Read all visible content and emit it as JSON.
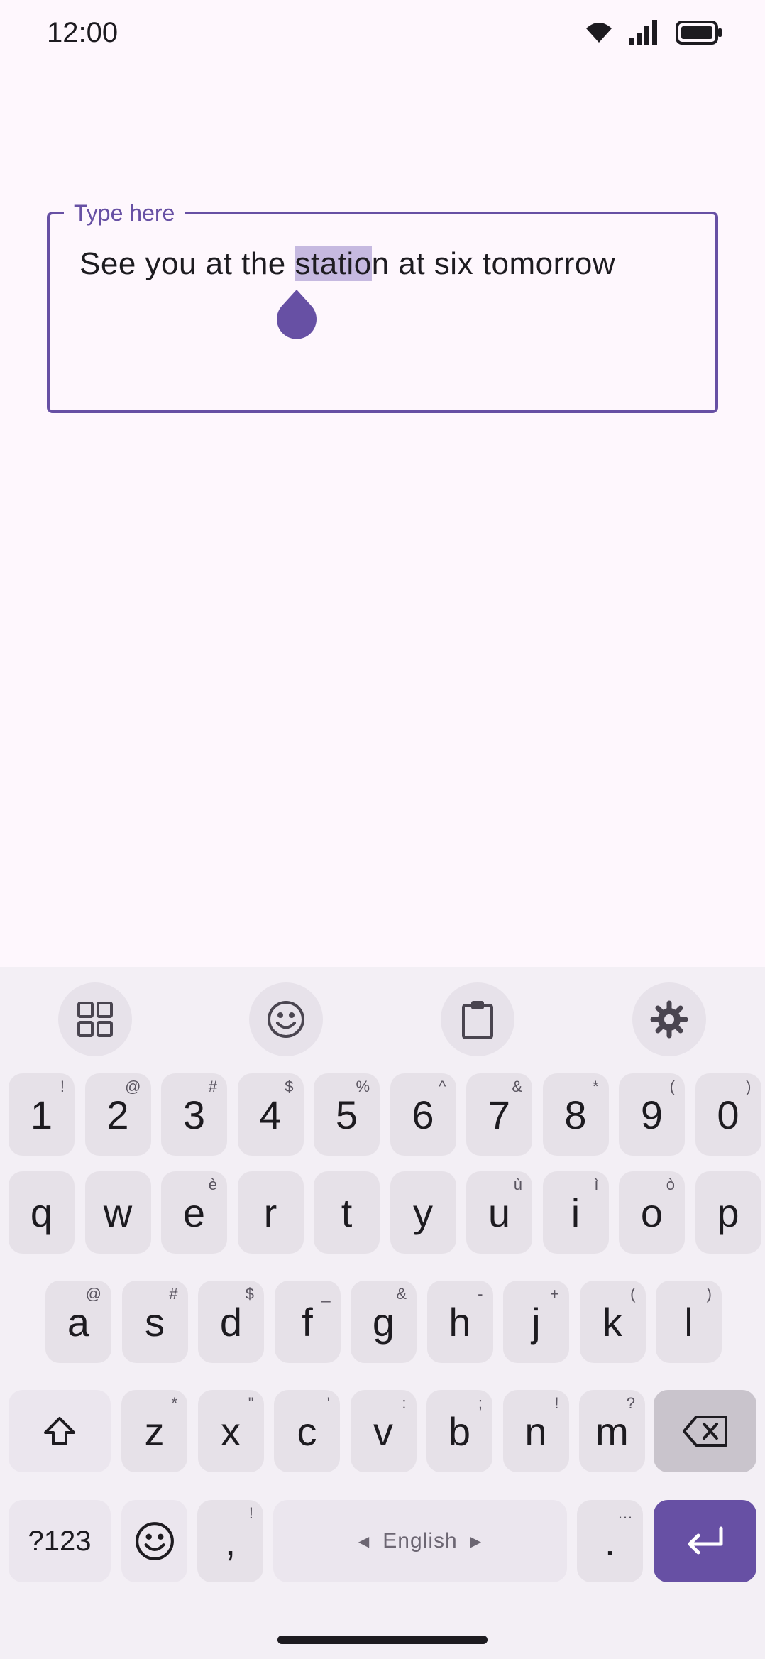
{
  "status": {
    "time": "12:00"
  },
  "field": {
    "label": "Type here",
    "text_before": "See you at the ",
    "text_selected": "statio",
    "text_after": "n at six tomorrow"
  },
  "keyboard": {
    "row_numbers": [
      {
        "main": "1",
        "hint": "!"
      },
      {
        "main": "2",
        "hint": "@"
      },
      {
        "main": "3",
        "hint": "#"
      },
      {
        "main": "4",
        "hint": "$"
      },
      {
        "main": "5",
        "hint": "%"
      },
      {
        "main": "6",
        "hint": "^"
      },
      {
        "main": "7",
        "hint": "&"
      },
      {
        "main": "8",
        "hint": "*"
      },
      {
        "main": "9",
        "hint": "("
      },
      {
        "main": "0",
        "hint": ")"
      }
    ],
    "row_q": [
      {
        "main": "q",
        "hint": ""
      },
      {
        "main": "w",
        "hint": ""
      },
      {
        "main": "e",
        "hint": "è"
      },
      {
        "main": "r",
        "hint": ""
      },
      {
        "main": "t",
        "hint": ""
      },
      {
        "main": "y",
        "hint": ""
      },
      {
        "main": "u",
        "hint": "ù"
      },
      {
        "main": "i",
        "hint": "ì"
      },
      {
        "main": "o",
        "hint": "ò"
      },
      {
        "main": "p",
        "hint": ""
      }
    ],
    "row_a": [
      {
        "main": "a",
        "hint": "@"
      },
      {
        "main": "s",
        "hint": "#"
      },
      {
        "main": "d",
        "hint": "$"
      },
      {
        "main": "f",
        "hint": "_"
      },
      {
        "main": "g",
        "hint": "&"
      },
      {
        "main": "h",
        "hint": "-"
      },
      {
        "main": "j",
        "hint": "+"
      },
      {
        "main": "k",
        "hint": "("
      },
      {
        "main": "l",
        "hint": ")"
      }
    ],
    "row_z": [
      {
        "main": "z",
        "hint": "*"
      },
      {
        "main": "x",
        "hint": "\""
      },
      {
        "main": "c",
        "hint": "'"
      },
      {
        "main": "v",
        "hint": ":"
      },
      {
        "main": "b",
        "hint": ";"
      },
      {
        "main": "n",
        "hint": "!"
      },
      {
        "main": "m",
        "hint": "?"
      }
    ],
    "symbols_label": "?123",
    "comma": {
      "main": ",",
      "hint": "!"
    },
    "space_label": "English",
    "period": {
      "main": ".",
      "hint": "…"
    }
  },
  "colors": {
    "accent": "#6750a4",
    "selection": "#c6b9e0",
    "key": "#e6e1e8",
    "background": "#fef7fd"
  }
}
